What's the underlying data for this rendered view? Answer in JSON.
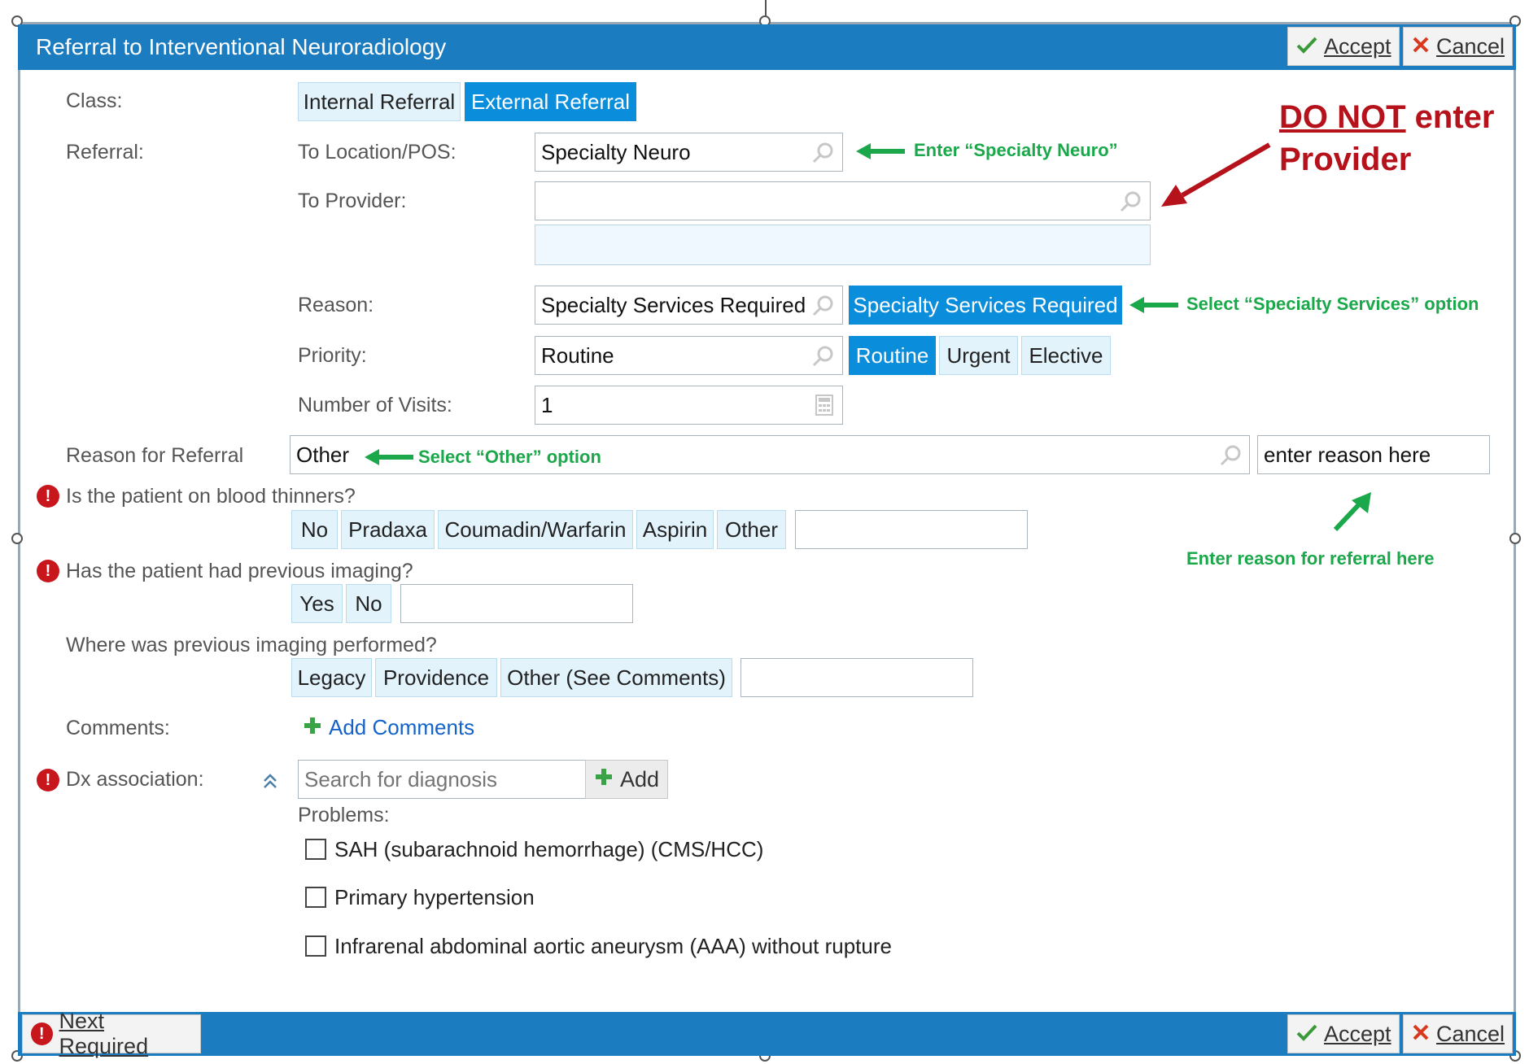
{
  "dialog": {
    "title": "Referral to Interventional Neuroradiology",
    "accept_label": "Accept",
    "cancel_label": "Cancel",
    "next_required_label": "Next Required"
  },
  "class": {
    "label": "Class:",
    "options": [
      "Internal Referral",
      "External Referral"
    ],
    "selected": "External Referral"
  },
  "referral": {
    "label": "Referral:",
    "to_location_label": "To Location/POS:",
    "to_location_value": "Specialty Neuro",
    "to_provider_label": "To Provider:",
    "to_provider_value": "",
    "reason_label": "Reason:",
    "reason_value": "Specialty Services Required",
    "reason_option": "Specialty Services Required",
    "priority_label": "Priority:",
    "priority_value": "Routine",
    "priority_options": [
      "Routine",
      "Urgent",
      "Elective"
    ],
    "priority_selected": "Routine",
    "visits_label": "Number of Visits:",
    "visits_value": "1"
  },
  "reason_for_referral": {
    "label": "Reason for Referral",
    "value": "Other",
    "detail_value": "enter reason here"
  },
  "blood_thinners": {
    "question": "Is the patient on blood thinners?",
    "options": [
      "No",
      "Pradaxa",
      "Coumadin/Warfarin",
      "Aspirin",
      "Other"
    ]
  },
  "previous_imaging": {
    "question": "Has the patient had previous imaging?",
    "options": [
      "Yes",
      "No"
    ]
  },
  "imaging_location": {
    "question": "Where was previous imaging performed?",
    "options": [
      "Legacy",
      "Providence",
      "Other (See Comments)"
    ]
  },
  "comments": {
    "label": "Comments:",
    "add_label": "Add Comments"
  },
  "dx": {
    "label": "Dx association:",
    "search_placeholder": "Search for diagnosis",
    "add_label": "Add",
    "problems_label": "Problems:",
    "problems": [
      "SAH (subarachnoid hemorrhage) (CMS/HCC)",
      "Primary hypertension",
      "Infrarenal abdominal aortic aneurysm (AAA) without rupture"
    ]
  },
  "annotations": {
    "enter_neuro": "Enter “Specialty Neuro”",
    "do_not_1": "DO NOT",
    "do_not_2": "enter",
    "do_not_3": "Provider",
    "select_specialty": "Select “Specialty Services” option",
    "select_other": "Select “Other” option",
    "enter_reason": "Enter reason for referral here"
  },
  "colors": {
    "titlebar": "#1c7cc0",
    "selected": "#0a8ddb",
    "unselected": "#e3f3fc",
    "annotation_green": "#1aa84a",
    "annotation_red": "#b5121b",
    "required": "#c8161d"
  }
}
